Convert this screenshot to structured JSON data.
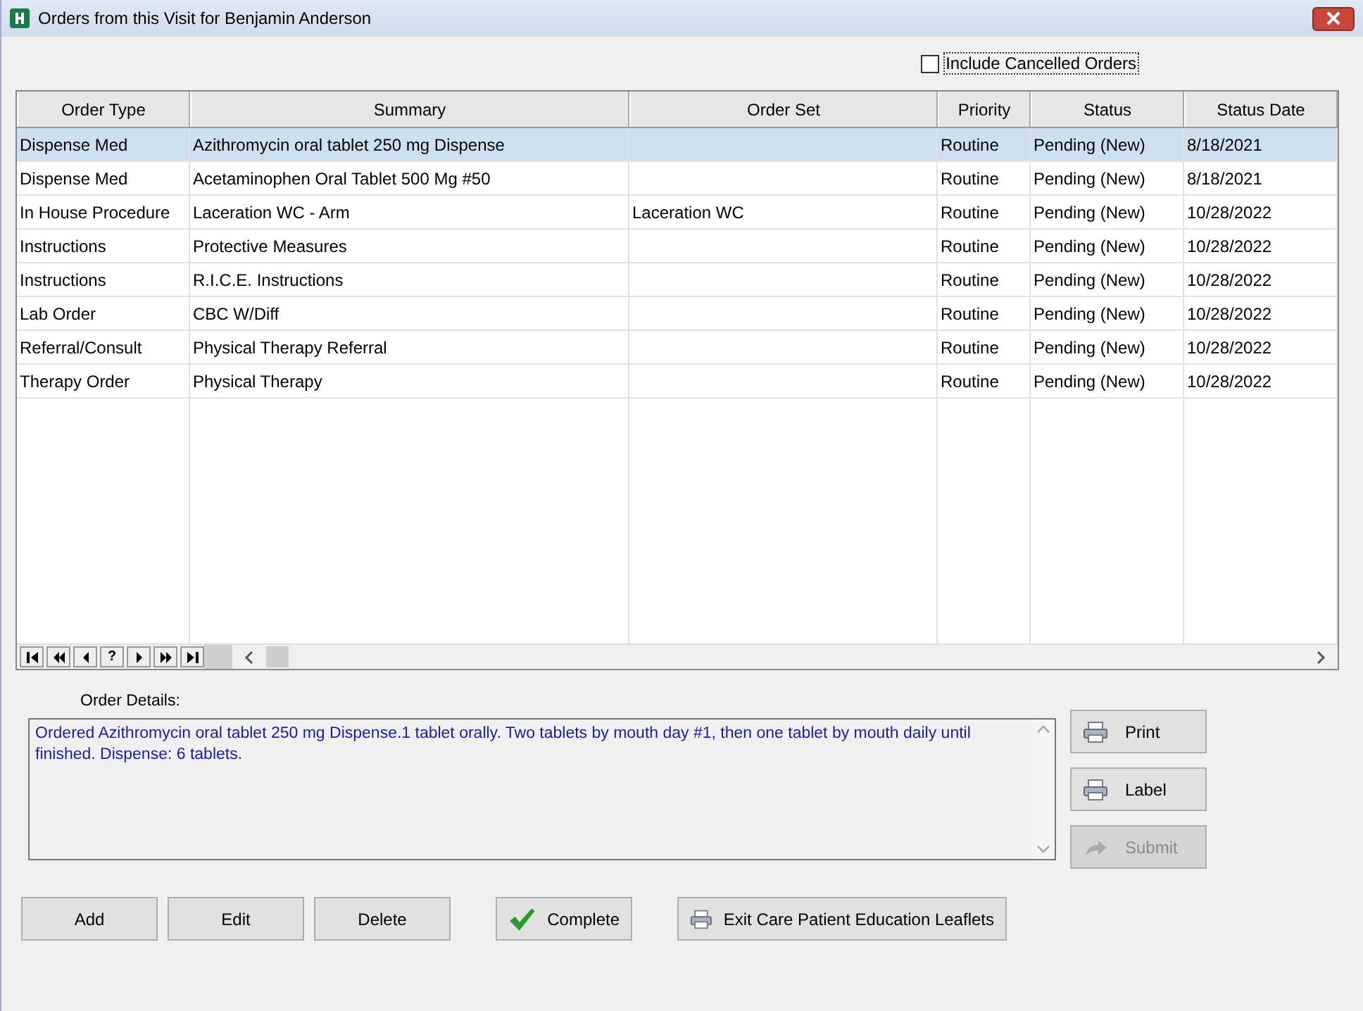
{
  "window": {
    "title": "Orders from this Visit for Benjamin Anderson"
  },
  "include_cancelled": {
    "label": "Include Cancelled Orders",
    "checked": false
  },
  "table": {
    "columns": [
      "Order Type",
      "Summary",
      "Order Set",
      "Priority",
      "Status",
      "Status Date"
    ],
    "rows": [
      {
        "cells": [
          "Dispense Med",
          "Azithromycin oral tablet 250 mg Dispense",
          "",
          "Routine",
          "Pending (New)",
          "8/18/2021"
        ],
        "selected": true
      },
      {
        "cells": [
          "Dispense Med",
          "Acetaminophen Oral Tablet 500 Mg #50",
          "",
          "Routine",
          "Pending (New)",
          "8/18/2021"
        ],
        "selected": false
      },
      {
        "cells": [
          "In House Procedure",
          "Laceration WC - Arm",
          "Laceration WC",
          "Routine",
          "Pending (New)",
          "10/28/2022"
        ],
        "selected": false
      },
      {
        "cells": [
          "Instructions",
          "Protective Measures",
          "",
          "Routine",
          "Pending (New)",
          "10/28/2022"
        ],
        "selected": false
      },
      {
        "cells": [
          "Instructions",
          "R.I.C.E. Instructions",
          "",
          "Routine",
          "Pending (New)",
          "10/28/2022"
        ],
        "selected": false
      },
      {
        "cells": [
          "Lab Order",
          "CBC W/Diff",
          "",
          "Routine",
          "Pending (New)",
          "10/28/2022"
        ],
        "selected": false
      },
      {
        "cells": [
          "Referral/Consult",
          "Physical Therapy Referral",
          "",
          "Routine",
          "Pending (New)",
          "10/28/2022"
        ],
        "selected": false
      },
      {
        "cells": [
          "Therapy Order",
          "Physical Therapy",
          "",
          "Routine",
          "Pending (New)",
          "10/28/2022"
        ],
        "selected": false
      }
    ],
    "navigator": [
      {
        "kind": "first"
      },
      {
        "kind": "prev-page"
      },
      {
        "kind": "prev"
      },
      {
        "kind": "help",
        "label": "?"
      },
      {
        "kind": "next"
      },
      {
        "kind": "next-page"
      },
      {
        "kind": "last"
      }
    ]
  },
  "order_details": {
    "label": "Order Details:",
    "text": "Ordered Azithromycin oral tablet 250 mg Dispense.1 tablet orally.  Two tablets by mouth day #1, then one tablet by mouth daily until finished. Dispense: 6 tablets."
  },
  "side_buttons": [
    {
      "label": "Print",
      "disabled": false
    },
    {
      "label": "Label",
      "disabled": false
    },
    {
      "label": "Submit",
      "disabled": true
    }
  ],
  "bottom_buttons": [
    {
      "label": "Add",
      "kind": "plain"
    },
    {
      "label": "Edit",
      "kind": "plain"
    },
    {
      "label": "Delete",
      "kind": "plain"
    },
    {
      "label": "Complete",
      "kind": "check"
    },
    {
      "label": "Exit Care Patient Education Leaflets",
      "kind": "print"
    }
  ]
}
